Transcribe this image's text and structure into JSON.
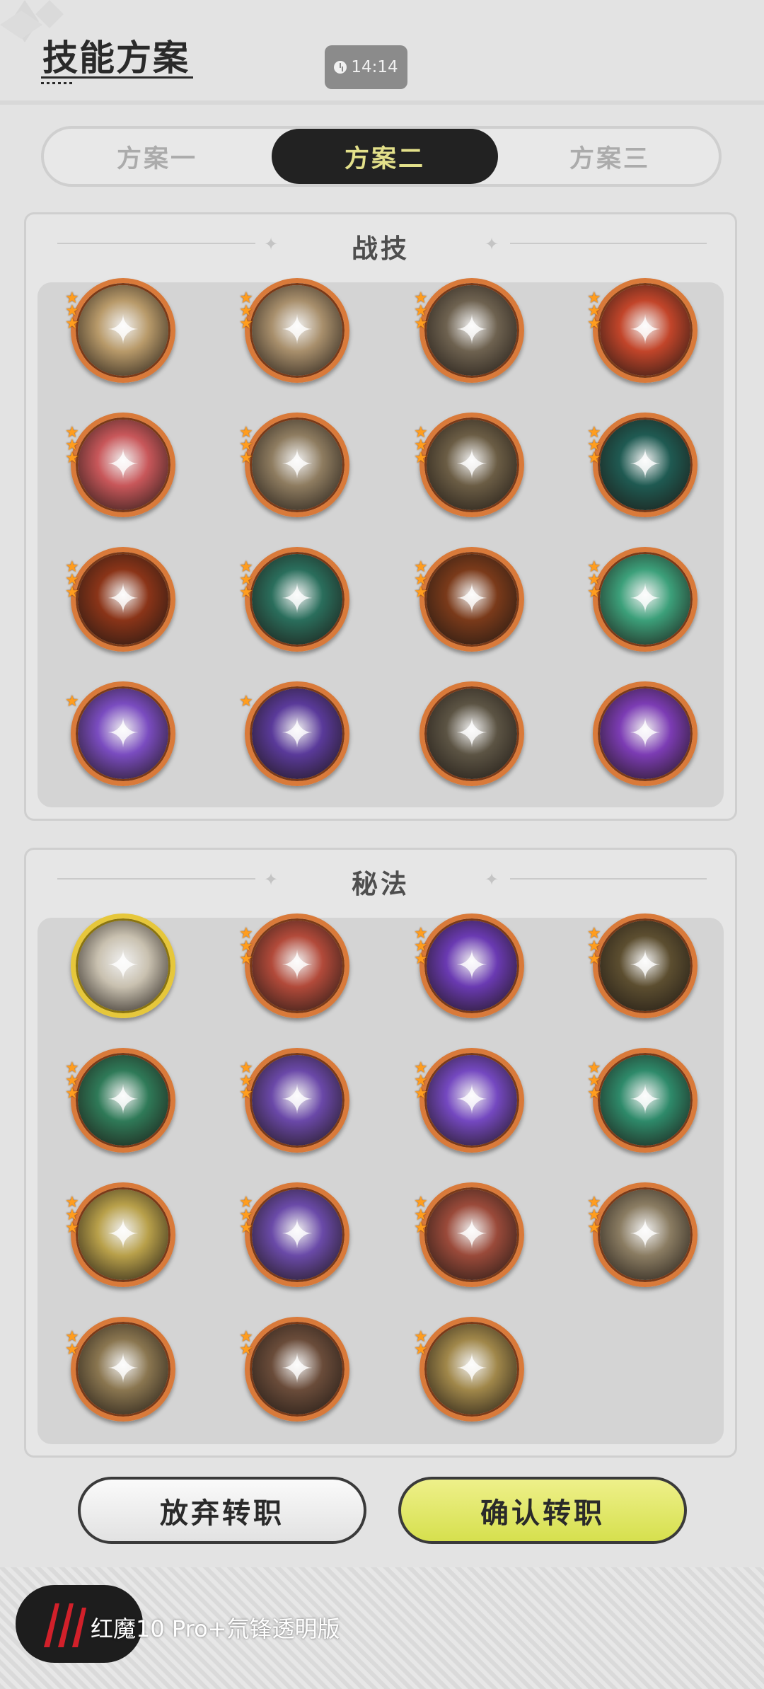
{
  "header": {
    "title": "技能方案",
    "clock": "14:14"
  },
  "tabs": [
    {
      "label": "方案一",
      "active": false
    },
    {
      "label": "方案二",
      "active": true
    },
    {
      "label": "方案三",
      "active": false
    }
  ],
  "combat": {
    "title": "战技",
    "skills": [
      {
        "icon": "burst-explosion-icon",
        "color": "#b89a6a",
        "stars": 3
      },
      {
        "icon": "whirlwind-slash-icon",
        "color": "#a88f6c",
        "stars": 3
      },
      {
        "icon": "lightning-slash-icon",
        "color": "#6e6250",
        "stars": 3
      },
      {
        "icon": "fire-crest-icon",
        "color": "#c2452a",
        "stars": 3
      },
      {
        "icon": "rage-figure-icon",
        "color": "#c8575a",
        "stars": 3
      },
      {
        "icon": "grab-hand-icon",
        "color": "#8e7c60",
        "stars": 3
      },
      {
        "icon": "crescent-axe-icon",
        "color": "#6b5d45",
        "stars": 3
      },
      {
        "icon": "web-net-icon",
        "color": "#1f5a52",
        "stars": 3
      },
      {
        "icon": "fire-arc-icon",
        "color": "#8a3418",
        "stars": 3
      },
      {
        "icon": "green-sword-icon",
        "color": "#2a6e5c",
        "stars": 3
      },
      {
        "icon": "flame-ring-icon",
        "color": "#7a3a1a",
        "stars": 3
      },
      {
        "icon": "green-arrows-icon",
        "color": "#3ca07a",
        "stars": 3
      },
      {
        "icon": "purple-heart-icon",
        "color": "#7a4cc0",
        "stars": 1
      },
      {
        "icon": "shadow-rogue-icon",
        "color": "#5a3a9a",
        "stars": 1
      },
      {
        "icon": "wind-slash-icon",
        "color": "#5c5444",
        "stars": 0
      },
      {
        "icon": "purple-comet-icon",
        "color": "#7c3cb4",
        "stars": 0
      }
    ]
  },
  "secret": {
    "title": "秘法",
    "skills": [
      {
        "icon": "sword-upgrade-icon",
        "color": "#c9c1b0",
        "stars": 0,
        "gold": true
      },
      {
        "icon": "red-rune-icon",
        "color": "#b24a3a",
        "stars": 3
      },
      {
        "icon": "purple-flame-icon",
        "color": "#6a3ab2",
        "stars": 3
      },
      {
        "icon": "armor-icon",
        "color": "#5c4e30",
        "stars": 3
      },
      {
        "icon": "green-heart-icon",
        "color": "#2f7a58",
        "stars": 3
      },
      {
        "icon": "beast-charge-icon",
        "color": "#6a48a8",
        "stars": 3
      },
      {
        "icon": "purple-silhouette-icon",
        "color": "#7448c0",
        "stars": 3
      },
      {
        "icon": "green-blade-icon",
        "color": "#2e8a6a",
        "stars": 3
      },
      {
        "icon": "yellow-heal-icon",
        "color": "#b8a04a",
        "stars": 3
      },
      {
        "icon": "purple-vortex-icon",
        "color": "#6a4aa8",
        "stars": 3
      },
      {
        "icon": "red-fist-icon",
        "color": "#9a4a3a",
        "stars": 3
      },
      {
        "icon": "moon-leaf-icon",
        "color": "#8a7c62",
        "stars": 3
      },
      {
        "icon": "tan-kick-icon",
        "color": "#8a7650",
        "stars": 2
      },
      {
        "icon": "heart-shield-icon",
        "color": "#6a4c3a",
        "stars": 2
      },
      {
        "icon": "golden-vortex-icon",
        "color": "#a0874a",
        "stars": 2
      }
    ]
  },
  "buttons": {
    "cancel": "放弃转职",
    "confirm": "确认转职"
  },
  "watermark": {
    "text": "红魔10 Pro+氘锋透明版"
  }
}
